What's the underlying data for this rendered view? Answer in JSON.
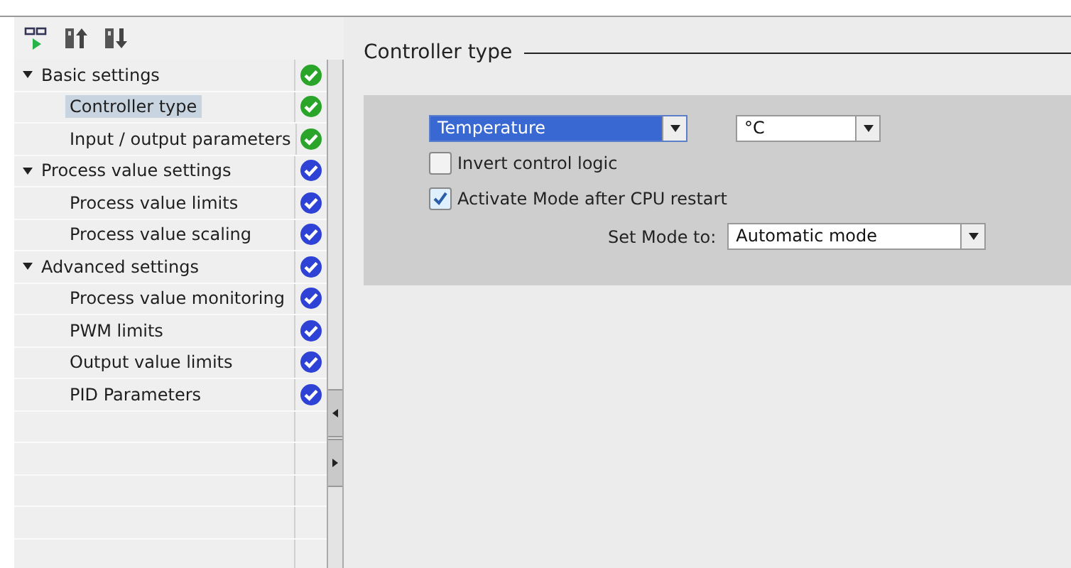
{
  "tree": [
    {
      "label": "Basic settings",
      "expanded": true,
      "selected": false,
      "color": "#2aa52a",
      "children": [
        {
          "label": "Controller type",
          "selected": true,
          "color": "#2aa52a"
        },
        {
          "label": "Input / output parameters",
          "selected": false,
          "color": "#2aa52a"
        }
      ]
    },
    {
      "label": "Process value settings",
      "expanded": true,
      "selected": false,
      "color": "#2e43d6",
      "children": [
        {
          "label": "Process value limits",
          "selected": false,
          "color": "#2e43d6"
        },
        {
          "label": "Process value scaling",
          "selected": false,
          "color": "#2e43d6"
        }
      ]
    },
    {
      "label": "Advanced settings",
      "expanded": true,
      "selected": false,
      "color": "#2e43d6",
      "children": [
        {
          "label": "Process value monitoring",
          "selected": false,
          "color": "#2e43d6"
        },
        {
          "label": "PWM limits",
          "selected": false,
          "color": "#2e43d6"
        },
        {
          "label": "Output value limits",
          "selected": false,
          "color": "#2e43d6"
        },
        {
          "label": "PID Parameters",
          "selected": false,
          "color": "#2e43d6"
        }
      ]
    }
  ],
  "section": {
    "title": "Controller type",
    "controller_type": {
      "value": "Temperature",
      "focused": true
    },
    "unit": {
      "value": "°C",
      "focused": false
    },
    "checkboxes": [
      {
        "label": "Invert control logic",
        "checked": false
      },
      {
        "label": "Activate Mode after CPU restart",
        "checked": true
      }
    ],
    "mode": {
      "label": "Set Mode to:",
      "value": "Automatic mode",
      "focused": false
    }
  }
}
